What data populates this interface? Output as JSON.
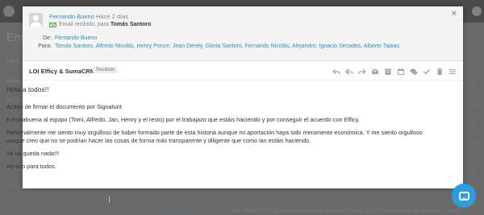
{
  "background": {
    "page_title": "Em",
    "side_labels": [
      "Filtra",
      "Email",
      "De to",
      "De to",
      "Leido",
      "Más c"
    ],
    "side_link": "Geste",
    "bottom_row": {
      "name": "Gloria Santoro",
      "subject": "Re: URGENTE: Socios necesito que volváis a firmar la LOI. Totalmente de acuerdo",
      "date": "Ayer"
    }
  },
  "email": {
    "sender_name": "Fernando Bueno",
    "time_ago": "Hace 2 días",
    "received_text": "Email recibido, para",
    "received_to": "Tomás Santoro",
    "from_label": "De:",
    "from_value": "Fernando Bueno",
    "to_label": "Para:",
    "to_value": "Tomás Santoro, Alfredo Nicolás, Henry Ponce, Jean Derely, Gloria Santoro, Fernando Nicolás, Alejandro, Ignacio Secades, Alberto Tapias",
    "subject": "LOI Efficy & SumaCRM",
    "badge": "Recibido",
    "greeting": "Hola a todos!!",
    "paragraphs": [
      "Acabo de firmar el documento por Signaturit",
      "Enhorabuena al equipo (Tomi, Alfredo, Jan, Henry y el resto) por el trabajazo que estáis haciendo y por conseguir el acuerdo con Efficy.",
      "Personalmente me siento muy orgulloso de haber formado parte de esta historia aunque mi aportación haya sido meramente económica. Y me siento orgulloso porque creo que no se podrían hacer las cosas de forma más transparente y diligente que como las estáis haciendo.",
      "Ya no queda nada!!!",
      "Abrazo para todos."
    ],
    "close_label": "×"
  },
  "colors": {
    "link": "#2a8fc5",
    "chat_button": "#2c9de1"
  }
}
